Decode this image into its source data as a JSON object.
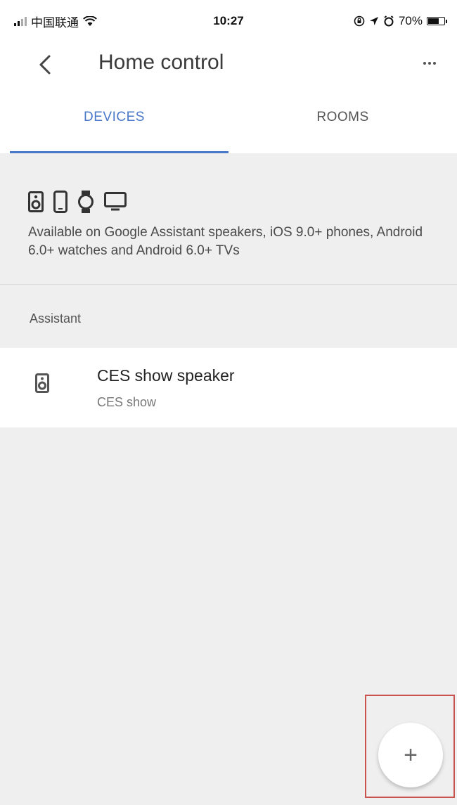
{
  "status_bar": {
    "carrier": "中国联通",
    "time": "10:27",
    "battery": "70%"
  },
  "app_bar": {
    "title": "Home control",
    "back_icon": "chevron-left-icon",
    "more_icon": "more-horizontal-icon"
  },
  "tabs": [
    {
      "label": "DEVICES",
      "active": true
    },
    {
      "label": "ROOMS",
      "active": false
    }
  ],
  "info": {
    "icons": [
      "speaker-icon",
      "phone-icon",
      "watch-icon",
      "tv-icon"
    ],
    "text": "Available on Google Assistant speakers, iOS 9.0+ phones, Android 6.0+ watches and Android 6.0+ TVs"
  },
  "section": {
    "label": "Assistant"
  },
  "devices": [
    {
      "name": "CES show speaker",
      "room": "CES show",
      "icon": "speaker-icon"
    }
  ],
  "fab": {
    "label": "+",
    "icon": "plus-icon"
  },
  "colors": {
    "accent": "#4a78c9",
    "background": "#efefef",
    "highlight": "#c9534f"
  }
}
